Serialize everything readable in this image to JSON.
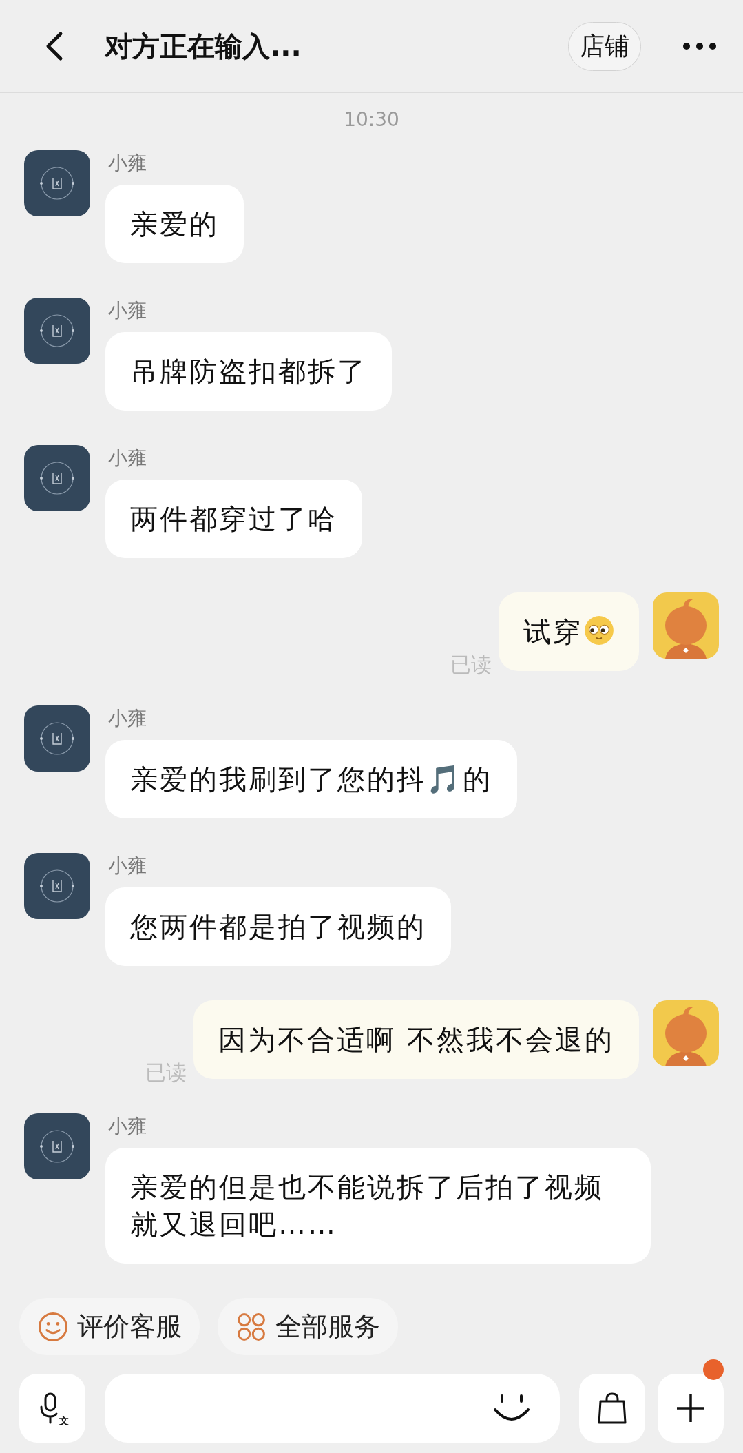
{
  "header": {
    "title": "对方正在输入...",
    "shop_button": "店铺"
  },
  "timestamp": "10:30",
  "messages": [
    {
      "kind": "incoming",
      "sender": "小雍",
      "text": "亲爱的"
    },
    {
      "kind": "incoming",
      "sender": "小雍",
      "text": "吊牌防盗扣都拆了"
    },
    {
      "kind": "incoming",
      "sender": "小雍",
      "text": "两件都穿过了哈"
    },
    {
      "kind": "outgoing",
      "text": "试穿",
      "trailing_emoji": true,
      "status": "已读"
    },
    {
      "kind": "incoming",
      "sender": "小雍",
      "text": "亲爱的我刷到了您的抖🎵的"
    },
    {
      "kind": "incoming",
      "sender": "小雍",
      "text": "您两件都是拍了视频的"
    },
    {
      "kind": "outgoing",
      "text": "因为不合适啊 不然我不会退的",
      "status": "已读"
    },
    {
      "kind": "incoming",
      "sender": "小雍",
      "text": "亲爱的但是也不能说拆了后拍了视频就又退回吧……"
    }
  ],
  "quick_actions": [
    {
      "kind": "rate",
      "label": "评价客服"
    },
    {
      "kind": "services",
      "label": "全部服务"
    }
  ],
  "input_bar": {
    "voice_icon_label": "文",
    "plus_badge": true
  }
}
